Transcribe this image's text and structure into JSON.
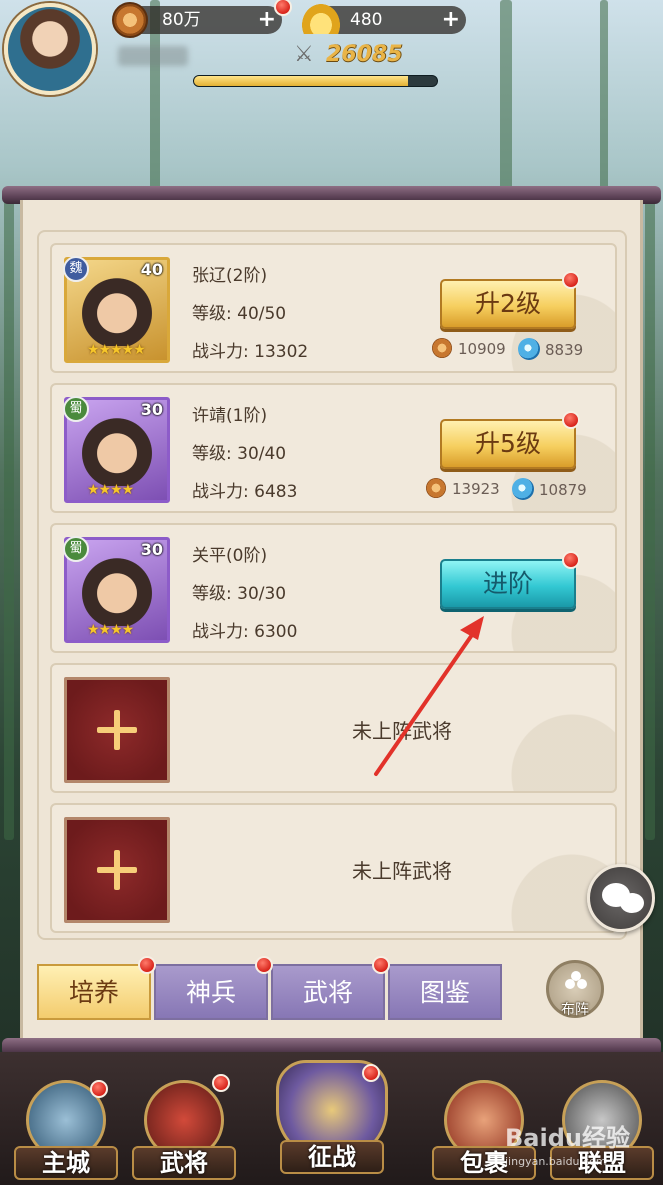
{
  "hud": {
    "coins": "80万",
    "ingots": "480",
    "power": "26085",
    "exp_fraction": 0.88
  },
  "heroes": [
    {
      "name": "张辽(2阶)",
      "faction": "魏",
      "level_badge": "40",
      "level": "等级: 40/50",
      "power": "战斗力: 13302",
      "action": "升2级",
      "cost_coins": "10909",
      "cost_spirit": "8839"
    },
    {
      "name": "许靖(1阶)",
      "faction": "蜀",
      "level_badge": "30",
      "level": "等级: 30/40",
      "power": "战斗力: 6483",
      "action": "升5级",
      "cost_coins": "13923",
      "cost_spirit": "10879"
    },
    {
      "name": "关平(0阶)",
      "faction": "蜀",
      "level_badge": "30",
      "level": "等级: 30/30",
      "power": "战斗力: 6300",
      "action": "进阶"
    }
  ],
  "empty_slots": [
    "未上阵武将",
    "未上阵武将"
  ],
  "tabs": [
    "培养",
    "神兵",
    "武将",
    "图鉴"
  ],
  "formation_label": "布阵",
  "nav": [
    "主城",
    "武将",
    "征战",
    "包裹",
    "联盟"
  ],
  "watermark": {
    "brand": "Baidu经验",
    "url": "jingyan.baidu.com"
  },
  "colors": {
    "action_yellow": "#f6cf5f",
    "action_cyan": "#33c8d3",
    "notification_red": "#d8241b",
    "panel_bg": "#eee5d6"
  }
}
